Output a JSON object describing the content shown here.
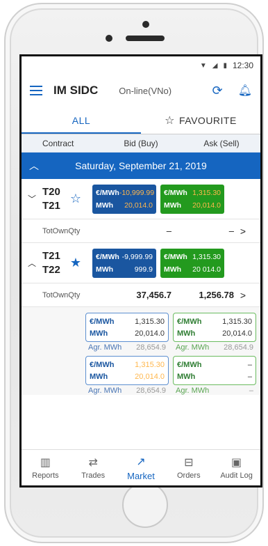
{
  "status_bar": {
    "time": "12:30"
  },
  "app_bar": {
    "title": "IM SIDC",
    "connection": "On-line(VNo)"
  },
  "tabs": [
    {
      "label": "ALL",
      "active": true
    },
    {
      "label": "FAVOURITE",
      "active": false
    }
  ],
  "columns": {
    "contract": "Contract",
    "bid": "Bid (Buy)",
    "ask": "Ask (Sell)"
  },
  "date_header": "Saturday, September 21, 2019",
  "contracts": [
    {
      "name_top": "T20",
      "name_bottom": "T21",
      "favourite": false,
      "bid": {
        "price_label": "€/MWh",
        "price": "-10,999.99",
        "qty_label": "MWh",
        "qty": "20,014.0"
      },
      "ask": {
        "price_label": "€/MWh",
        "price": "1,315.30",
        "qty_label": "MWh",
        "qty": "20,014.0"
      },
      "own": {
        "label": "TotOwnQty",
        "bid": "–",
        "ask": "–"
      }
    },
    {
      "name_top": "T21",
      "name_bottom": "T22",
      "favourite": true,
      "bid": {
        "price_label": "€/MWh",
        "price": "-9,999.99",
        "qty_label": "MWh",
        "qty": "999.9"
      },
      "ask": {
        "price_label": "€/MWh",
        "price": "1,315.30",
        "qty_label": "MWh",
        "qty": "20 014.0"
      },
      "own": {
        "label": "TotOwnQty",
        "bid": "37,456.7",
        "ask": "1,256.78"
      }
    }
  ],
  "depth": [
    {
      "bid": {
        "price_label": "€/MWh",
        "price": "1,315.30",
        "qty_label": "MWh",
        "qty": "20,014.0",
        "agr_label": "Agr. MWh",
        "agr": "28,654.9"
      },
      "ask": {
        "price_label": "€/MWh",
        "price": "1,315.30",
        "qty_label": "MWh",
        "qty": "20,014.0",
        "agr_label": "Agr. MWh",
        "agr": "28,654.9"
      }
    },
    {
      "bid": {
        "price_label": "€/MWh",
        "price": "1,315.30",
        "qty_label": "MWh",
        "qty": "20,014.0",
        "agr_label": "Agr. MWh",
        "agr": "28,654.9"
      },
      "ask": {
        "price_label": "€/MWh",
        "price": "–",
        "qty_label": "MWh",
        "qty": "–",
        "agr_label": "Agr. MWh",
        "agr": "–"
      }
    }
  ],
  "bottom_nav": [
    {
      "label": "Reports",
      "icon": "reports-icon"
    },
    {
      "label": "Trades",
      "icon": "trades-icon"
    },
    {
      "label": "Market",
      "icon": "market-icon",
      "active": true
    },
    {
      "label": "Orders",
      "icon": "orders-icon"
    },
    {
      "label": "Audit Log",
      "icon": "audit-log-icon"
    }
  ],
  "colors": {
    "primary": "#1565c0",
    "bid": "#1a56a0",
    "ask": "#239a1e",
    "highlight": "#ffb74d"
  }
}
